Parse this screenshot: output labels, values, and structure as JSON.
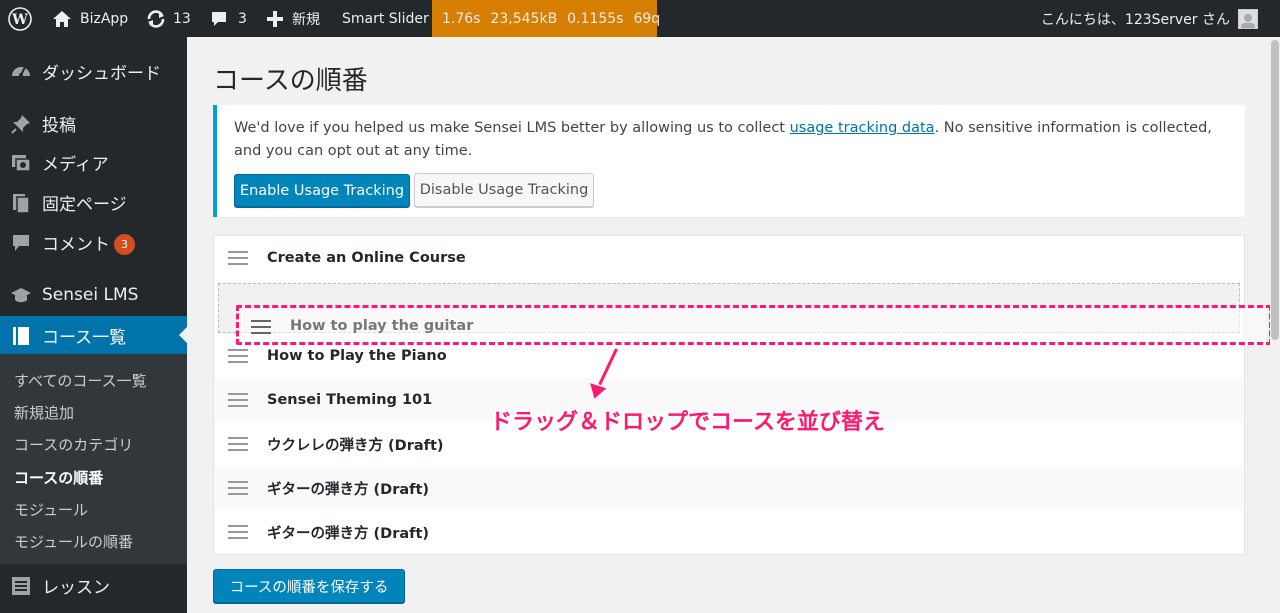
{
  "admin_bar": {
    "site_name": "BizApp",
    "updates_count": "13",
    "comments_count": "3",
    "new_label": "新規",
    "smart_slider_label": "Smart Slider",
    "perf": [
      "1.76s",
      "23,545kB",
      "0.1155s",
      "69q"
    ],
    "greeting": "こんにちは、123Server さん",
    "perf_color": "#d67e00"
  },
  "sidebar": {
    "items": [
      {
        "label": "ダッシュボード",
        "icon": "dashboard-icon"
      },
      {
        "label": "投稿",
        "icon": "pin-icon"
      },
      {
        "label": "メディア",
        "icon": "media-icon"
      },
      {
        "label": "固定ページ",
        "icon": "page-icon"
      },
      {
        "label": "コメント",
        "icon": "comment-icon",
        "badge": "3"
      },
      {
        "label": "Sensei LMS",
        "icon": "graduation-cap-icon"
      },
      {
        "label": "コース一覧",
        "icon": "book-icon",
        "current": true
      },
      {
        "label": "レッスン",
        "icon": "list-icon"
      }
    ],
    "submenu": [
      {
        "label": "すべてのコース一覧"
      },
      {
        "label": "新規追加"
      },
      {
        "label": "コースのカテゴリ"
      },
      {
        "label": "コースの順番",
        "current": true
      },
      {
        "label": "モジュール"
      },
      {
        "label": "モジュールの順番"
      }
    ],
    "current_color": "#0073aa"
  },
  "main": {
    "title": "コースの順番",
    "notice": {
      "text_before": "We'd love if you helped us make Sensei LMS better by allowing us to collect ",
      "link_text": "usage tracking data",
      "text_after": ". No sensitive information is collected, and you can opt out at any time.",
      "enable_button": "Enable Usage Tracking",
      "disable_button": "Disable Usage Tracking"
    },
    "courses": [
      "Create an Online Course",
      "How to Play the Piano",
      "Sensei Theming 101",
      "ウクレレの弾き方 (Draft)",
      "ギターの弾き方 (Draft)",
      "ギターの弾き方 (Draft)"
    ],
    "dragging_course": "How to play the guitar",
    "annotation": "ドラッグ＆ドロップでコースを並び替え",
    "annotation_color": "#ff1a6d",
    "save_button": "コースの順番を保存する"
  }
}
